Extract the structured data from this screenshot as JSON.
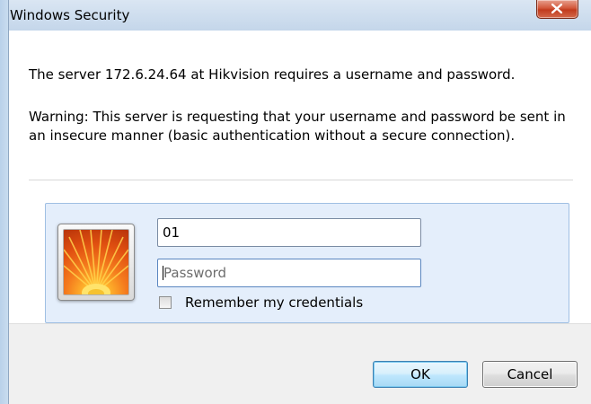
{
  "window": {
    "title": "Windows Security",
    "close_icon": "close-x-icon"
  },
  "message": "The server 172.6.24.64 at Hikvision requires a username and password.",
  "warning": "Warning: This server is requesting that your username and password be sent in an insecure manner (basic authentication without a secure connection).",
  "credentials": {
    "tile_icon": "flower-user-tile-icon",
    "username_value": "01",
    "password_value": "",
    "password_placeholder": "Password",
    "remember_label": "Remember my credentials",
    "remember_checked": false
  },
  "buttons": {
    "ok_label": "OK",
    "cancel_label": "Cancel"
  },
  "colors": {
    "close_button": "#c9462a",
    "panel_background": "#e4eefb",
    "panel_border": "#9fbfe3",
    "ok_button": "#bee6fd"
  }
}
